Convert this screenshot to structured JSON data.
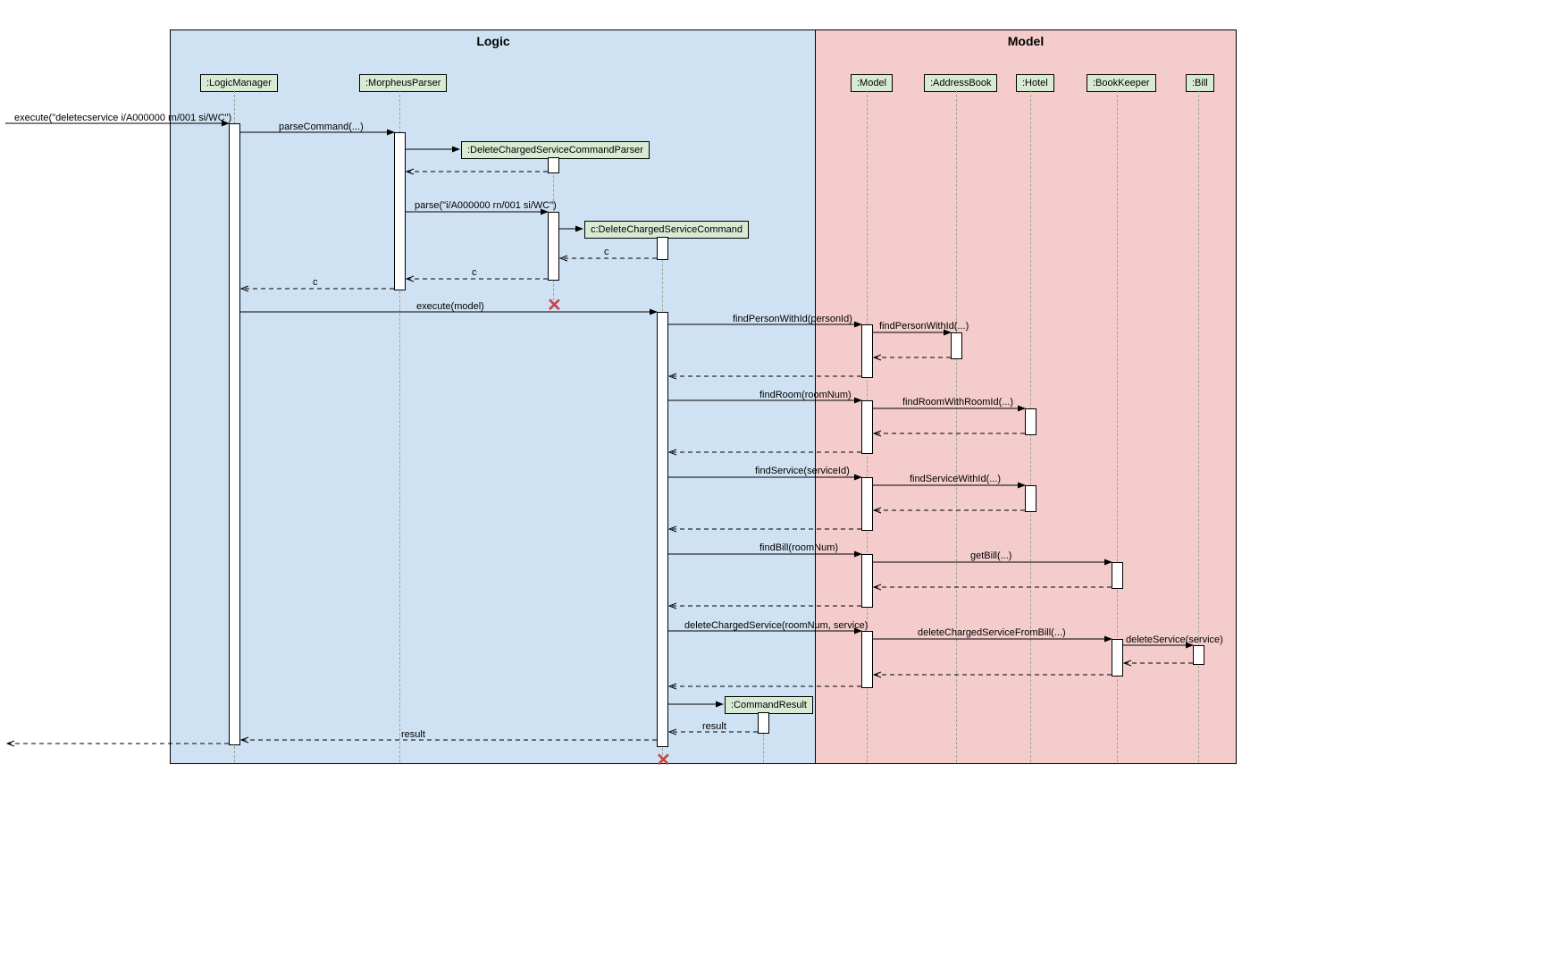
{
  "regions": {
    "logic": "Logic",
    "model": "Model"
  },
  "participants": {
    "logicmgr": ":LogicManager",
    "mparser": ":MorpheusParser",
    "dcparser": ":DeleteChargedServiceCommandParser",
    "dcmd": "c:DeleteChargedServiceCommand",
    "cresult": ":CommandResult",
    "model": ":Model",
    "abook": ":AddressBook",
    "hotel": ":Hotel",
    "bkeeper": ":BookKeeper",
    "bill": ":Bill"
  },
  "messages": {
    "execute_start": "execute(\"deletecservice i/A000000 rn/001 si/WC\")",
    "parseCommand": "parseCommand(...)",
    "parse": "parse(\"i/A000000 rn/001 si/WC\")",
    "c": "c",
    "execmodel": "execute(model)",
    "findPerson": "findPersonWithId(personId)",
    "findPerson2": "findPersonWithId(...)",
    "findRoom": "findRoom(roomNum)",
    "findRoomId": "findRoomWithRoomId(...)",
    "findService": "findService(serviceId)",
    "findServiceId": "findServiceWithId(...)",
    "findBill": "findBill(roomNum)",
    "getBill": "getBill(...)",
    "delCharged": "deleteChargedService(roomNum, service)",
    "delFromBill": "deleteChargedServiceFromBill(...)",
    "delService": "deleteService(service)",
    "result": "result"
  },
  "chart_data": {
    "type": "sequence_diagram",
    "participants": [
      {
        "id": "logicmgr",
        "label": ":LogicManager",
        "region": "Logic"
      },
      {
        "id": "mparser",
        "label": ":MorpheusParser",
        "region": "Logic"
      },
      {
        "id": "dcparser",
        "label": ":DeleteChargedServiceCommandParser",
        "region": "Logic",
        "created_by": "mparser",
        "destroyed": true
      },
      {
        "id": "dcmd",
        "label": "c:DeleteChargedServiceCommand",
        "region": "Logic",
        "created_by": "dcparser",
        "destroyed": true
      },
      {
        "id": "cresult",
        "label": ":CommandResult",
        "region": "Logic",
        "created_by": "dcmd"
      },
      {
        "id": "model",
        "label": ":Model",
        "region": "Model"
      },
      {
        "id": "abook",
        "label": ":AddressBook",
        "region": "Model"
      },
      {
        "id": "hotel",
        "label": ":Hotel",
        "region": "Model"
      },
      {
        "id": "bkeeper",
        "label": ":BookKeeper",
        "region": "Model"
      },
      {
        "id": "bill",
        "label": ":Bill",
        "region": "Model"
      }
    ],
    "messages": [
      {
        "from": "external",
        "to": "logicmgr",
        "label": "execute(\"deletecservice i/A000000 rn/001 si/WC\")",
        "type": "call"
      },
      {
        "from": "logicmgr",
        "to": "mparser",
        "label": "parseCommand(...)",
        "type": "call"
      },
      {
        "from": "mparser",
        "to": "dcparser",
        "label": "",
        "type": "create"
      },
      {
        "from": "dcparser",
        "to": "mparser",
        "label": "",
        "type": "return"
      },
      {
        "from": "mparser",
        "to": "dcparser",
        "label": "parse(\"i/A000000 rn/001 si/WC\")",
        "type": "call"
      },
      {
        "from": "dcparser",
        "to": "dcmd",
        "label": "",
        "type": "create"
      },
      {
        "from": "dcmd",
        "to": "dcparser",
        "label": "c",
        "type": "return"
      },
      {
        "from": "dcparser",
        "to": "mparser",
        "label": "c",
        "type": "return"
      },
      {
        "from": "mparser",
        "to": "logicmgr",
        "label": "c",
        "type": "return"
      },
      {
        "from": "logicmgr",
        "to": "dcmd",
        "label": "execute(model)",
        "type": "call"
      },
      {
        "from": "dcmd",
        "to": "model",
        "label": "findPersonWithId(personId)",
        "type": "call"
      },
      {
        "from": "model",
        "to": "abook",
        "label": "findPersonWithId(...)",
        "type": "call"
      },
      {
        "from": "abook",
        "to": "model",
        "label": "",
        "type": "return"
      },
      {
        "from": "model",
        "to": "dcmd",
        "label": "",
        "type": "return"
      },
      {
        "from": "dcmd",
        "to": "model",
        "label": "findRoom(roomNum)",
        "type": "call"
      },
      {
        "from": "model",
        "to": "hotel",
        "label": "findRoomWithRoomId(...)",
        "type": "call"
      },
      {
        "from": "hotel",
        "to": "model",
        "label": "",
        "type": "return"
      },
      {
        "from": "model",
        "to": "dcmd",
        "label": "",
        "type": "return"
      },
      {
        "from": "dcmd",
        "to": "model",
        "label": "findService(serviceId)",
        "type": "call"
      },
      {
        "from": "model",
        "to": "hotel",
        "label": "findServiceWithId(...)",
        "type": "call"
      },
      {
        "from": "hotel",
        "to": "model",
        "label": "",
        "type": "return"
      },
      {
        "from": "model",
        "to": "dcmd",
        "label": "",
        "type": "return"
      },
      {
        "from": "dcmd",
        "to": "model",
        "label": "findBill(roomNum)",
        "type": "call"
      },
      {
        "from": "model",
        "to": "bkeeper",
        "label": "getBill(...)",
        "type": "call"
      },
      {
        "from": "bkeeper",
        "to": "model",
        "label": "",
        "type": "return"
      },
      {
        "from": "model",
        "to": "dcmd",
        "label": "",
        "type": "return"
      },
      {
        "from": "dcmd",
        "to": "model",
        "label": "deleteChargedService(roomNum, service)",
        "type": "call"
      },
      {
        "from": "model",
        "to": "bkeeper",
        "label": "deleteChargedServiceFromBill(...)",
        "type": "call"
      },
      {
        "from": "bkeeper",
        "to": "bill",
        "label": "deleteService(service)",
        "type": "call"
      },
      {
        "from": "bill",
        "to": "bkeeper",
        "label": "",
        "type": "return"
      },
      {
        "from": "bkeeper",
        "to": "model",
        "label": "",
        "type": "return"
      },
      {
        "from": "model",
        "to": "dcmd",
        "label": "",
        "type": "return"
      },
      {
        "from": "dcmd",
        "to": "cresult",
        "label": "",
        "type": "create"
      },
      {
        "from": "dcmd",
        "to": "logicmgr",
        "label": "result",
        "type": "return"
      },
      {
        "from": "logicmgr",
        "to": "external",
        "label": "result",
        "type": "return"
      }
    ]
  }
}
